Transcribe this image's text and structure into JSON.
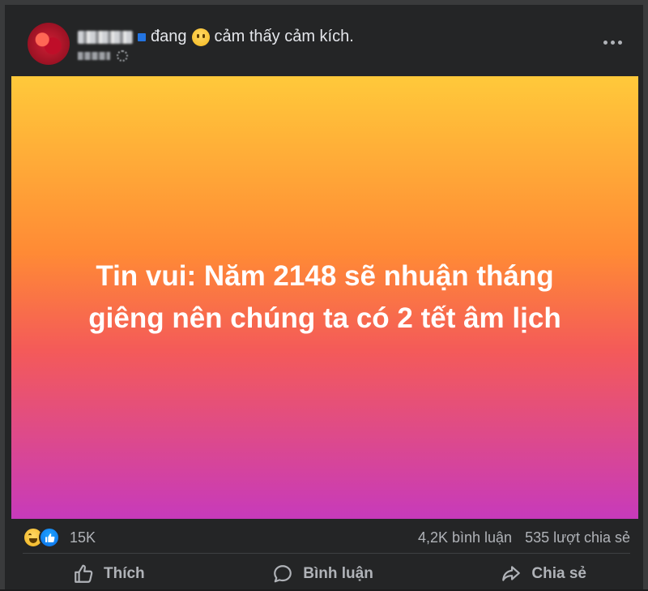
{
  "header": {
    "feeling_prefix": "đang",
    "feeling_text": "cảm thấy cảm kích.",
    "more_icon": "more-horizontal-icon"
  },
  "post": {
    "text_line1": "Tin vui: Năm 2148 sẽ nhuận tháng",
    "text_line2": "giêng nên chúng ta có 2 tết âm lịch",
    "background_colors": [
      "#ffc93a",
      "#ff8a35",
      "#f45a59",
      "#c73abb"
    ]
  },
  "stats": {
    "reaction_count": "15K",
    "comments": "4,2K bình luận",
    "shares": "535 lượt chia sẻ"
  },
  "actions": {
    "like_label": "Thích",
    "comment_label": "Bình luận",
    "share_label": "Chia sẻ"
  },
  "colors": {
    "card_bg": "#242526",
    "secondary_text": "#b0b3b8",
    "like_blue": "#1877f2"
  }
}
